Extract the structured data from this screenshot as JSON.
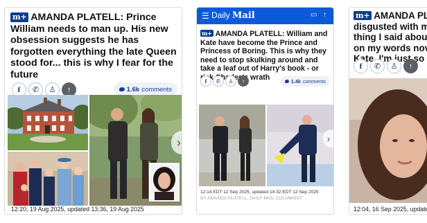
{
  "cards": [
    {
      "badge": "m+",
      "headline": "AMANDA PLATELL: Prince William needs to man up. His new obsession suggests he has forgotten everything the late Queen stood for... this is why I fear for the future",
      "comments": {
        "count": "1.6k",
        "label": "comments"
      },
      "timestamp": "12:20, 19 Aug 2025, updated 13:36, 19 Aug 2025"
    },
    {
      "app_title": {
        "prefix": "Daily",
        "suffix": "Mail"
      },
      "badge": "m+",
      "headline": "AMANDA PLATELL: William and Kate have become the Prince and Princess of Boring. This is why they need to stop skulking around and take a leaf out of Harry's book - or risk Charles's wrath",
      "comments": {
        "count": "1.4k",
        "label": "comments"
      },
      "timestamp": "12:14 EDT 12 Sep 2025, updated 14:32 EDT 12 Sep 2025",
      "byline": "By AMANDA PLATELL, DAILY MAIL COLUMNIST"
    },
    {
      "badge": "m+",
      "headline_lines": [
        "AMANDA PL",
        "disgusted with m",
        "thing I said abou",
        "on my words nov",
        "Kate, I'm just so"
      ],
      "timestamp": "12:04, 16 Sep 2025, updated"
    }
  ],
  "icons": {
    "facebook": "f",
    "whatsapp": "✆",
    "snapchat": "♙",
    "share": "↑",
    "menu": "☰",
    "chat": "▭",
    "next": "›"
  },
  "colors": {
    "brand_blue": "#0b5ad9",
    "badge_navy": "#0a3d91",
    "comment_text": "#1b3d8f",
    "comment_bg": "#eef1f6",
    "byline_grey": "#9aa3b2"
  }
}
